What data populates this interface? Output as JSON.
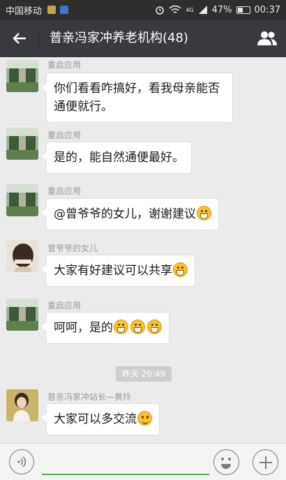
{
  "status_bar": {
    "carrier": "中国移动",
    "network": "4G",
    "battery": "47%",
    "battery_level": 0.47,
    "time": "00:37"
  },
  "header": {
    "title": "普亲冯家冲养老机构(48)"
  },
  "messages": [
    {
      "sender": "重启应用",
      "text": "你们看看咋搞好，看我母亲能否通便就行。",
      "emojis": []
    },
    {
      "sender": "重启应用",
      "text": "是的，能自然通便最好。",
      "emojis": []
    },
    {
      "sender": "重启应用",
      "text": "@曾爷爷的女儿，谢谢建议",
      "emojis": [
        "grin"
      ]
    },
    {
      "sender": "曾爷爷的女儿",
      "text": "大家有好建议可以共享",
      "emojis": [
        "grin"
      ]
    },
    {
      "sender": "重启应用",
      "text": "呵呵，是的",
      "emojis": [
        "grin",
        "grin",
        "grin"
      ]
    },
    {
      "sender": "普亲冯家冲站长—黄玲",
      "text": "大家可以多交流",
      "emojis": [
        "smile"
      ]
    }
  ],
  "time_divider": "昨天 20:49",
  "colors": {
    "header_bg": "#393a3f",
    "chat_bg": "#ebebeb",
    "input_accent": "#4cae4c"
  }
}
